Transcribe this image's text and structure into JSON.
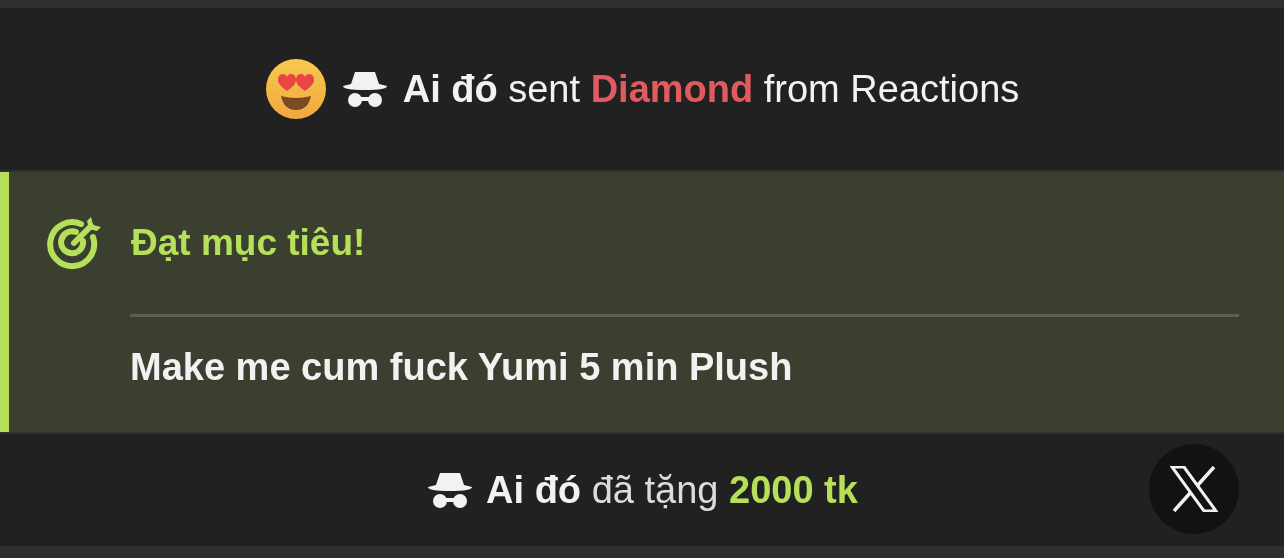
{
  "messages": [
    {
      "kind": "gift",
      "user": "Ai đó",
      "verb": "sent",
      "item": "Diamond",
      "suffix": "from Reactions"
    },
    {
      "kind": "goal",
      "title": "Đạt mục tiêu!",
      "text": "Make me cum fuck Yumi 5 min Plush"
    },
    {
      "kind": "tip",
      "user": "Ai đó",
      "verb": "đã tặng",
      "item": "2000 tk"
    }
  ]
}
